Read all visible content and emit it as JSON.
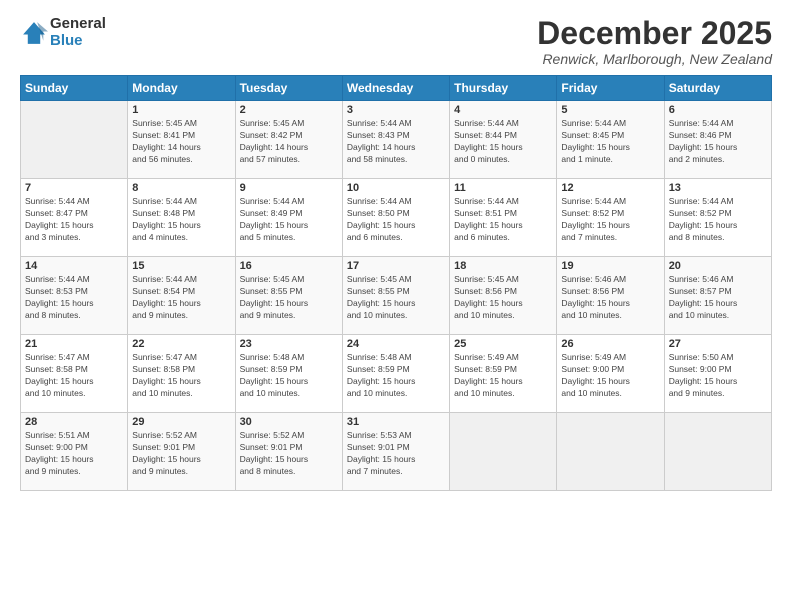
{
  "logo": {
    "line1": "General",
    "line2": "Blue"
  },
  "title": "December 2025",
  "location": "Renwick, Marlborough, New Zealand",
  "days_of_week": [
    "Sunday",
    "Monday",
    "Tuesday",
    "Wednesday",
    "Thursday",
    "Friday",
    "Saturday"
  ],
  "weeks": [
    [
      {
        "num": "",
        "info": ""
      },
      {
        "num": "1",
        "info": "Sunrise: 5:45 AM\nSunset: 8:41 PM\nDaylight: 14 hours\nand 56 minutes."
      },
      {
        "num": "2",
        "info": "Sunrise: 5:45 AM\nSunset: 8:42 PM\nDaylight: 14 hours\nand 57 minutes."
      },
      {
        "num": "3",
        "info": "Sunrise: 5:44 AM\nSunset: 8:43 PM\nDaylight: 14 hours\nand 58 minutes."
      },
      {
        "num": "4",
        "info": "Sunrise: 5:44 AM\nSunset: 8:44 PM\nDaylight: 15 hours\nand 0 minutes."
      },
      {
        "num": "5",
        "info": "Sunrise: 5:44 AM\nSunset: 8:45 PM\nDaylight: 15 hours\nand 1 minute."
      },
      {
        "num": "6",
        "info": "Sunrise: 5:44 AM\nSunset: 8:46 PM\nDaylight: 15 hours\nand 2 minutes."
      }
    ],
    [
      {
        "num": "7",
        "info": "Sunrise: 5:44 AM\nSunset: 8:47 PM\nDaylight: 15 hours\nand 3 minutes."
      },
      {
        "num": "8",
        "info": "Sunrise: 5:44 AM\nSunset: 8:48 PM\nDaylight: 15 hours\nand 4 minutes."
      },
      {
        "num": "9",
        "info": "Sunrise: 5:44 AM\nSunset: 8:49 PM\nDaylight: 15 hours\nand 5 minutes."
      },
      {
        "num": "10",
        "info": "Sunrise: 5:44 AM\nSunset: 8:50 PM\nDaylight: 15 hours\nand 6 minutes."
      },
      {
        "num": "11",
        "info": "Sunrise: 5:44 AM\nSunset: 8:51 PM\nDaylight: 15 hours\nand 6 minutes."
      },
      {
        "num": "12",
        "info": "Sunrise: 5:44 AM\nSunset: 8:52 PM\nDaylight: 15 hours\nand 7 minutes."
      },
      {
        "num": "13",
        "info": "Sunrise: 5:44 AM\nSunset: 8:52 PM\nDaylight: 15 hours\nand 8 minutes."
      }
    ],
    [
      {
        "num": "14",
        "info": "Sunrise: 5:44 AM\nSunset: 8:53 PM\nDaylight: 15 hours\nand 8 minutes."
      },
      {
        "num": "15",
        "info": "Sunrise: 5:44 AM\nSunset: 8:54 PM\nDaylight: 15 hours\nand 9 minutes."
      },
      {
        "num": "16",
        "info": "Sunrise: 5:45 AM\nSunset: 8:55 PM\nDaylight: 15 hours\nand 9 minutes."
      },
      {
        "num": "17",
        "info": "Sunrise: 5:45 AM\nSunset: 8:55 PM\nDaylight: 15 hours\nand 10 minutes."
      },
      {
        "num": "18",
        "info": "Sunrise: 5:45 AM\nSunset: 8:56 PM\nDaylight: 15 hours\nand 10 minutes."
      },
      {
        "num": "19",
        "info": "Sunrise: 5:46 AM\nSunset: 8:56 PM\nDaylight: 15 hours\nand 10 minutes."
      },
      {
        "num": "20",
        "info": "Sunrise: 5:46 AM\nSunset: 8:57 PM\nDaylight: 15 hours\nand 10 minutes."
      }
    ],
    [
      {
        "num": "21",
        "info": "Sunrise: 5:47 AM\nSunset: 8:58 PM\nDaylight: 15 hours\nand 10 minutes."
      },
      {
        "num": "22",
        "info": "Sunrise: 5:47 AM\nSunset: 8:58 PM\nDaylight: 15 hours\nand 10 minutes."
      },
      {
        "num": "23",
        "info": "Sunrise: 5:48 AM\nSunset: 8:59 PM\nDaylight: 15 hours\nand 10 minutes."
      },
      {
        "num": "24",
        "info": "Sunrise: 5:48 AM\nSunset: 8:59 PM\nDaylight: 15 hours\nand 10 minutes."
      },
      {
        "num": "25",
        "info": "Sunrise: 5:49 AM\nSunset: 8:59 PM\nDaylight: 15 hours\nand 10 minutes."
      },
      {
        "num": "26",
        "info": "Sunrise: 5:49 AM\nSunset: 9:00 PM\nDaylight: 15 hours\nand 10 minutes."
      },
      {
        "num": "27",
        "info": "Sunrise: 5:50 AM\nSunset: 9:00 PM\nDaylight: 15 hours\nand 9 minutes."
      }
    ],
    [
      {
        "num": "28",
        "info": "Sunrise: 5:51 AM\nSunset: 9:00 PM\nDaylight: 15 hours\nand 9 minutes."
      },
      {
        "num": "29",
        "info": "Sunrise: 5:52 AM\nSunset: 9:01 PM\nDaylight: 15 hours\nand 9 minutes."
      },
      {
        "num": "30",
        "info": "Sunrise: 5:52 AM\nSunset: 9:01 PM\nDaylight: 15 hours\nand 8 minutes."
      },
      {
        "num": "31",
        "info": "Sunrise: 5:53 AM\nSunset: 9:01 PM\nDaylight: 15 hours\nand 7 minutes."
      },
      {
        "num": "",
        "info": ""
      },
      {
        "num": "",
        "info": ""
      },
      {
        "num": "",
        "info": ""
      }
    ]
  ]
}
